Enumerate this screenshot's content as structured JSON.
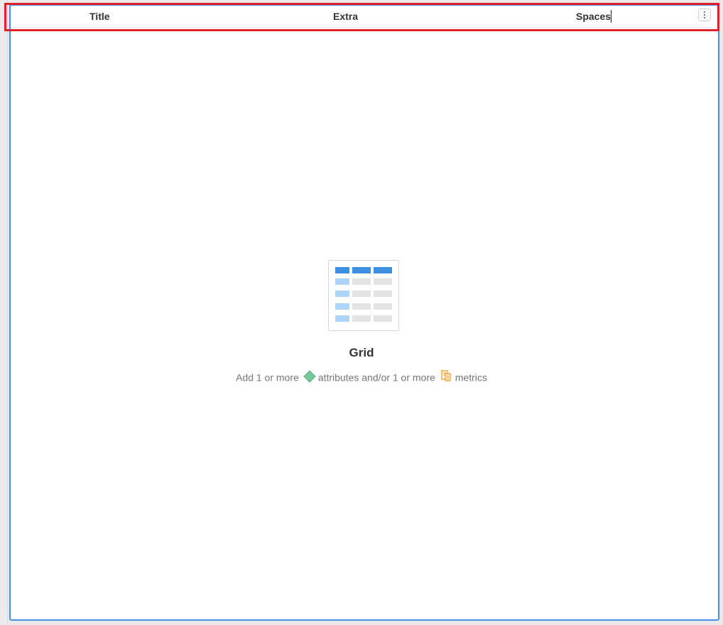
{
  "header": {
    "columns": [
      {
        "label": "Title"
      },
      {
        "label": "Extra"
      },
      {
        "label": "Spaces"
      }
    ],
    "menu_icon": "vertical-ellipsis-icon"
  },
  "empty_state": {
    "icon": "grid-table-icon",
    "title": "Grid",
    "desc_prefix": "Add 1 or more",
    "attribute_icon": "attribute-diamond-icon",
    "desc_middle": "attributes and/or 1 or more",
    "metric_icon": "metric-icon",
    "desc_suffix": "metrics"
  },
  "colors": {
    "selection_border": "#4a90e2",
    "highlight_border": "#e0202a",
    "grid_header_blue": "#3d8fe0",
    "grid_row_light_blue": "#aed4f8",
    "grid_cell_gray": "#e3e3e3",
    "attribute_green": "#7ac79a",
    "metric_orange": "#f0a33a"
  }
}
